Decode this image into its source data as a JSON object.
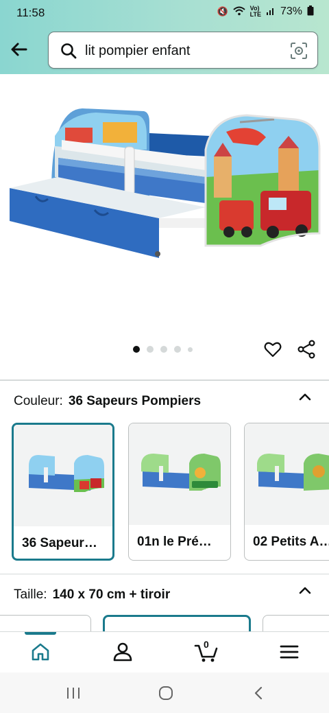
{
  "status_bar": {
    "time": "11:58",
    "battery": "73%",
    "icons": [
      "mute-icon",
      "wifi-icon",
      "volte-icon",
      "signal-icon",
      "battery-icon"
    ]
  },
  "header": {
    "search_query": "lit pompier enfant",
    "icons": [
      "back-arrow-icon",
      "search-icon",
      "camera-lens-icon"
    ]
  },
  "gallery": {
    "page_count": 5,
    "current_page": 1
  },
  "color_variation": {
    "label": "Couleur:",
    "value": "36 Sapeurs Pompiers",
    "options": [
      {
        "name": "36 Sapeur…",
        "selected": true
      },
      {
        "name": "01n le Pré…",
        "selected": false
      },
      {
        "name": "02 Petits A…",
        "selected": false
      }
    ]
  },
  "size_variation": {
    "label": "Taille:",
    "value": "140 x 70 cm + tiroir"
  },
  "bottom_nav": {
    "items": [
      "home-icon",
      "account-icon",
      "cart-icon",
      "menu-icon"
    ],
    "cart_count": "0"
  },
  "system_nav": [
    "recents-icon",
    "home-circle-icon",
    "back-chevron-icon"
  ],
  "colors": {
    "header_gradient_start": "#8ad6d0",
    "header_gradient_end": "#b8e6cf",
    "selection_border": "#1a7a8c",
    "text_primary": "#0f1111"
  }
}
